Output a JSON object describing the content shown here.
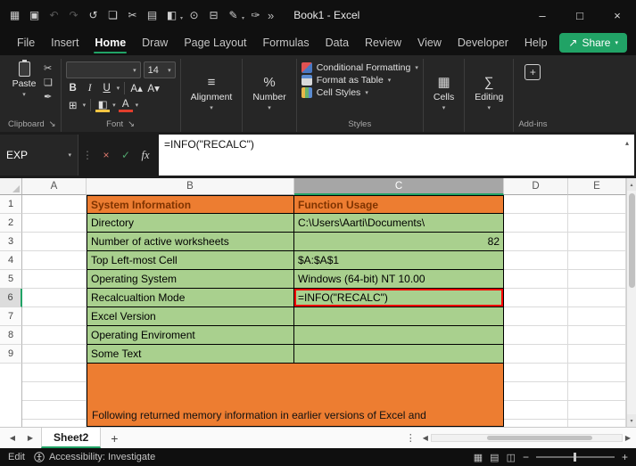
{
  "colors": {
    "accent": "#21A366",
    "orange": "#ED7D31",
    "orange-text": "#7F3300",
    "green": "#A9D08E",
    "red": "#FF0000"
  },
  "ui": {
    "caret": "▾",
    "up": "▴",
    "left": "◀",
    "right": "▶",
    "vdots": "⋮",
    "cut": "✂",
    "copy": "❏",
    "brush": "✒",
    "launcher": "↘",
    "grow_font": "A▴",
    "shrink_font": "A▾",
    "borders": "⊞",
    "fill": "◧",
    "font_color": "A",
    "align_icon": "≡",
    "percent_icon": "%",
    "cells_icon": "▦",
    "editing_icon": "∑",
    "addin_plus": "+",
    "view_normal": "▦",
    "view_layout": "▤",
    "view_break": "◫",
    "share_icon": "↗",
    "overflow": "»"
  },
  "titlebar": {
    "title": "Book1 - Excel",
    "qat": [
      {
        "name": "apps-icon",
        "glyph": "▦"
      },
      {
        "name": "save-icon",
        "glyph": "▣"
      },
      {
        "name": "undo-icon",
        "glyph": "↶"
      },
      {
        "name": "redo-icon",
        "glyph": "↷"
      },
      {
        "name": "history-icon",
        "glyph": "↺"
      },
      {
        "name": "copy-icon",
        "glyph": "❏"
      },
      {
        "name": "cut-icon",
        "glyph": "✂"
      },
      {
        "name": "clipboard-icon",
        "glyph": "▤"
      },
      {
        "name": "fill-color-icon",
        "glyph": "◧"
      },
      {
        "name": "camera-icon",
        "glyph": "⊙"
      },
      {
        "name": "print-icon",
        "glyph": "⊟"
      },
      {
        "name": "draw-icon",
        "glyph": "✎"
      },
      {
        "name": "pin-icon",
        "glyph": "✑"
      }
    ],
    "window": {
      "minimize": "–",
      "maximize": "□",
      "close": "×"
    }
  },
  "menu": {
    "tabs": [
      "File",
      "Insert",
      "Home",
      "Draw",
      "Page Layout",
      "Formulas",
      "Data",
      "Review",
      "View",
      "Developer",
      "Help"
    ],
    "share": "Share"
  },
  "ribbon": {
    "paste": "Paste",
    "clipboard_label": "Clipboard",
    "font_label": "Font",
    "font_name": "",
    "font_size": "14",
    "bold": "B",
    "italic": "I",
    "underline": "U",
    "alignment": "Alignment",
    "number": "Number",
    "styles_label": "Styles",
    "styles_items": [
      "Conditional Formatting",
      "Format as Table",
      "Cell Styles"
    ],
    "cells": "Cells",
    "editing": "Editing",
    "addins": "Add-ins"
  },
  "formula_bar": {
    "name_box": "EXP",
    "cancel": "×",
    "enter": "✓",
    "fx": "fx",
    "formula": "=INFO(\"RECALC\")"
  },
  "grid": {
    "columns": [
      "A",
      "B",
      "C",
      "D",
      "E"
    ],
    "rows": [
      {
        "num": "1",
        "b": "System Information",
        "c": "Function Usage"
      },
      {
        "num": "2",
        "b": "Directory",
        "c": "C:\\Users\\Aarti\\Documents\\"
      },
      {
        "num": "3",
        "b": "Number of active worksheets",
        "c": "82"
      },
      {
        "num": "4",
        "b": "Top Left-most Cell",
        "c": "$A:$A$1"
      },
      {
        "num": "5",
        "b": "Operating System",
        "c": "Windows (64-bit) NT 10.00"
      },
      {
        "num": "6",
        "b": "Recalcualtion Mode",
        "c": "=INFO(\"RECALC\")"
      },
      {
        "num": "7",
        "b": "Excel Version",
        "c": ""
      },
      {
        "num": "8",
        "b": "Operating Enviroment",
        "c": ""
      },
      {
        "num": "9",
        "b": "Some Text",
        "c": ""
      }
    ],
    "note": "Following returned memory information in earlier versions of Excel and"
  },
  "sheet_bar": {
    "tab": "Sheet2",
    "add": "+"
  },
  "status_bar": {
    "mode": "Edit",
    "accessibility": "Accessibility: Investigate",
    "zoom_minus": "−",
    "zoom_plus": "+"
  }
}
